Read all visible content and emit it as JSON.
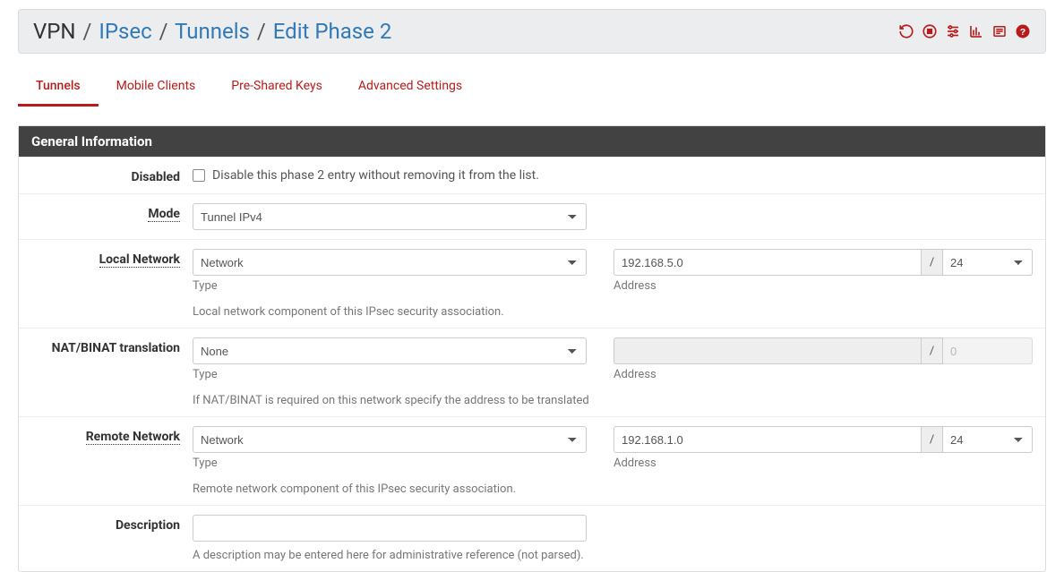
{
  "breadcrumb": {
    "part1": "VPN",
    "part2": "IPsec",
    "part3": "Tunnels",
    "part4": "Edit Phase 2"
  },
  "tabs": [
    "Tunnels",
    "Mobile Clients",
    "Pre-Shared Keys",
    "Advanced Settings"
  ],
  "activeTab": "Tunnels",
  "panel": {
    "title": "General Information",
    "rows": {
      "disabled": {
        "label": "Disabled",
        "text": "Disable this phase 2 entry without removing it from the list."
      },
      "mode": {
        "label": "Mode",
        "value": "Tunnel IPv4"
      },
      "local": {
        "label": "Local Network",
        "type_value": "Network",
        "type_sub": "Type",
        "addr_value": "192.168.5.0",
        "addr_sub": "Address",
        "cidr": "24",
        "help": "Local network component of this IPsec security association."
      },
      "nat": {
        "label": "NAT/BINAT translation",
        "type_value": "None",
        "type_sub": "Type",
        "addr_value": "",
        "addr_sub": "Address",
        "cidr": "0",
        "help": "If NAT/BINAT is required on this network specify the address to be translated"
      },
      "remote": {
        "label": "Remote Network",
        "type_value": "Network",
        "type_sub": "Type",
        "addr_value": "192.168.1.0",
        "addr_sub": "Address",
        "cidr": "24",
        "help": "Remote network component of this IPsec security association."
      },
      "desc": {
        "label": "Description",
        "value": "",
        "help": "A description may be entered here for administrative reference (not parsed)."
      }
    }
  }
}
